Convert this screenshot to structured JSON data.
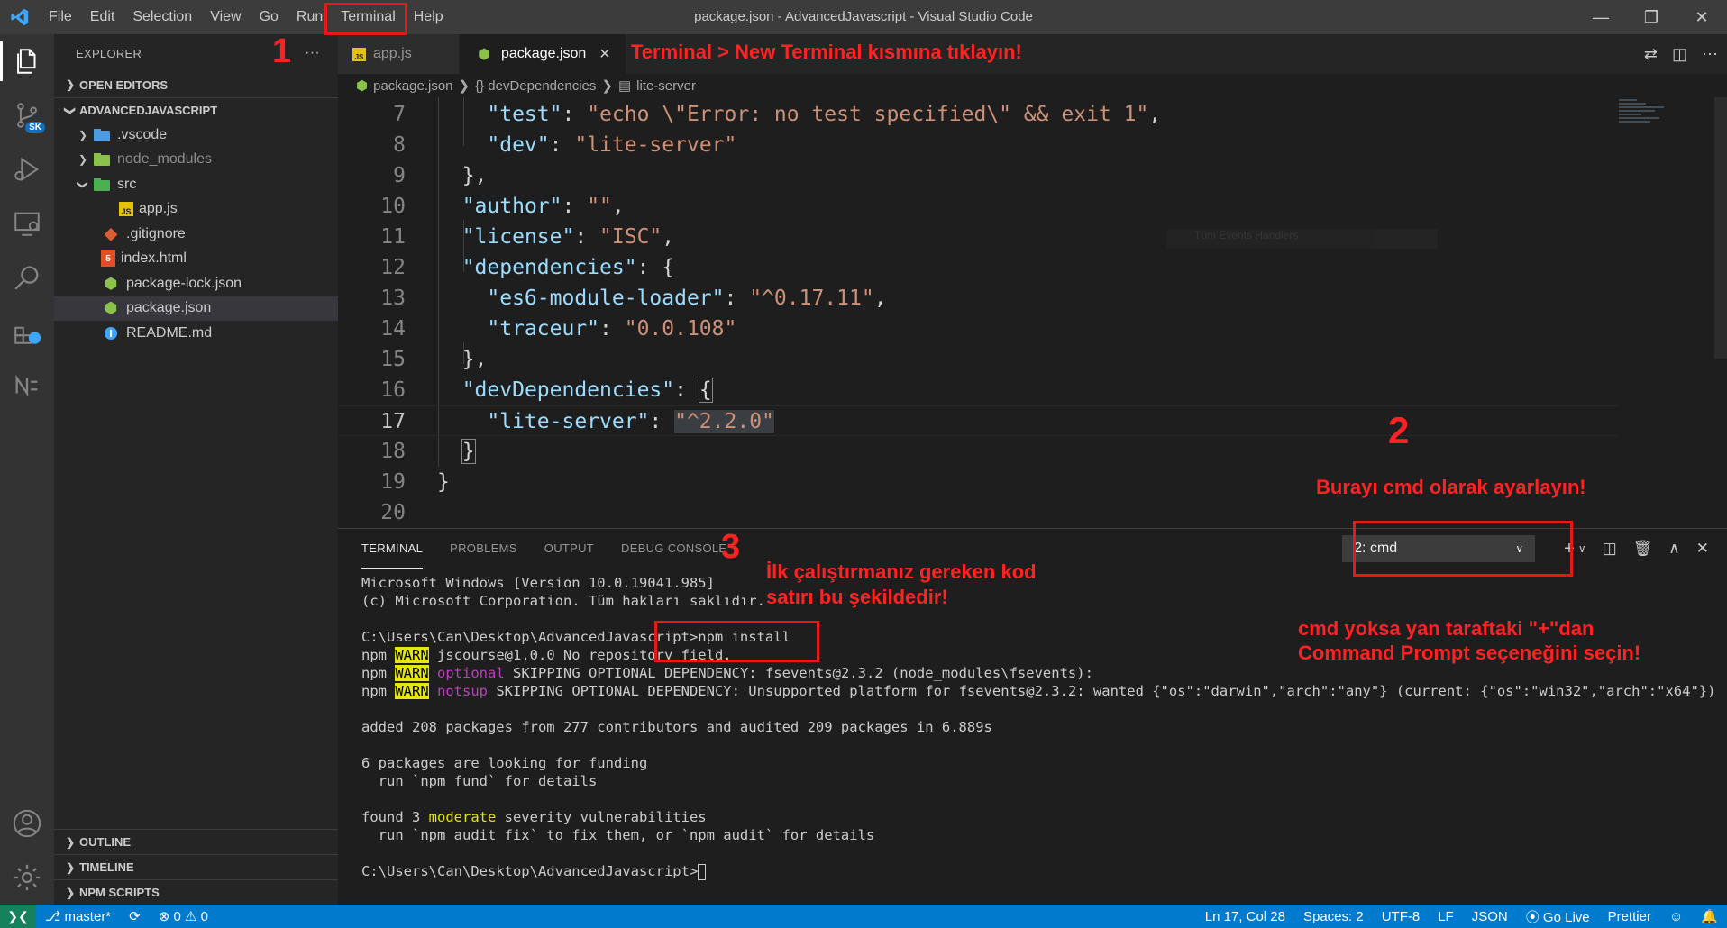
{
  "window": {
    "title": "package.json - AdvancedJavascript - Visual Studio Code",
    "menu": [
      "File",
      "Edit",
      "Selection",
      "View",
      "Go",
      "Run",
      "Terminal",
      "Help"
    ]
  },
  "sidebar": {
    "header": "EXPLORER",
    "more": "···",
    "open_editors": "OPEN EDITORS",
    "project": "ADVANCEDJAVASCRIPT",
    "items": [
      {
        "label": ".vscode",
        "icon": "folder-icon"
      },
      {
        "label": "node_modules",
        "icon": "folder-icon"
      },
      {
        "label": "src",
        "icon": "folder-open-icon"
      },
      {
        "label": "app.js",
        "icon": "js-file-icon"
      },
      {
        "label": ".gitignore",
        "icon": "git-file-icon"
      },
      {
        "label": "index.html",
        "icon": "html-file-icon"
      },
      {
        "label": "package-lock.json",
        "icon": "node-file-icon"
      },
      {
        "label": "package.json",
        "icon": "node-file-icon"
      },
      {
        "label": "README.md",
        "icon": "info-file-icon"
      }
    ],
    "outline": "OUTLINE",
    "timeline": "TIMELINE",
    "npm_scripts": "NPM SCRIPTS"
  },
  "tabs": [
    {
      "label": "app.js",
      "active": false
    },
    {
      "label": "package.json",
      "active": true
    }
  ],
  "breadcrumb": [
    "package.json",
    "{} devDependencies",
    "lite-server"
  ],
  "code": {
    "line_numbers": [
      "7",
      "8",
      "9",
      "10",
      "11",
      "12",
      "13",
      "14",
      "15",
      "16",
      "17",
      "18",
      "19",
      "20"
    ],
    "current_line": "17",
    "hover_ghost": "Tüm Events Handlers"
  },
  "panel": {
    "tabs": [
      "TERMINAL",
      "PROBLEMS",
      "OUTPUT",
      "DEBUG CONSOLE"
    ],
    "terminal_select": "2: cmd",
    "lines": {
      "l1": "Microsoft Windows [Version 10.0.19041.985]",
      "l2": "(c) Microsoft Corporation. Tüm hakları saklıdır.",
      "l3": "C:\\Users\\Can\\Desktop\\AdvancedJavascript>npm install",
      "npm": "npm",
      "warn": "WARN",
      "l4": " jscourse@1.0.0 No repository field.",
      "optional": "optional",
      "l5": " SKIPPING OPTIONAL DEPENDENCY: fsevents@2.3.2 (node_modules\\fsevents):",
      "notsup": "notsup",
      "l6": " SKIPPING OPTIONAL DEPENDENCY: Unsupported platform for fsevents@2.3.2: wanted {\"os\":\"darwin\",\"arch\":\"any\"} (current: {\"os\":\"win32\",\"arch\":\"x64\"})",
      "l7": "added 208 packages from 277 contributors and audited 209 packages in 6.889s",
      "l8": "6 packages are looking for funding",
      "l9": "  run `npm fund` for details",
      "l10a": "found 3 ",
      "l10b": "moderate",
      "l10c": " severity vulnerabilities",
      "l11": "  run `npm audit fix` to fix them, or `npm audit` for details",
      "l12": "C:\\Users\\Can\\Desktop\\AdvancedJavascript>"
    }
  },
  "status": {
    "branch": "master*",
    "errors": "0",
    "warnings": "0",
    "position": "Ln 17, Col 28",
    "spaces": "Spaces: 2",
    "encoding": "UTF-8",
    "eol": "LF",
    "language": "JSON",
    "golive": "Go Live",
    "prettier": "Prettier"
  },
  "annotations": {
    "n1": "1",
    "n2": "2",
    "n3": "3",
    "a1": "Terminal > New Terminal kısmına tıklayın!",
    "a2": "Burayı cmd olarak ayarlayın!",
    "a3a": "İlk çalıştırmanız gereken kod",
    "a3b": "satırı bu şekildedir!",
    "a4a": "cmd yoksa yan taraftaki \"+\"dan",
    "a4b": "Command Prompt seçeneğini seçin!"
  },
  "colors": {
    "accent": "#007acc",
    "annotation": "#ff2222",
    "json_key": "#9cdcfe",
    "json_string": "#ce9178"
  }
}
